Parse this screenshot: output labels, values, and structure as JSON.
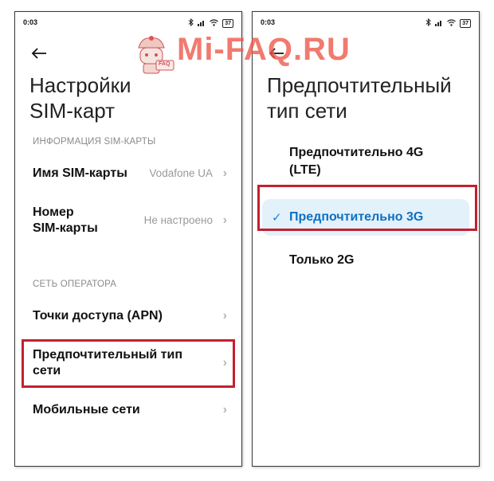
{
  "watermark": {
    "text": "Mi-FAQ.RU",
    "badge": "FAQ"
  },
  "left": {
    "status": {
      "time": "0:03",
      "battery": "37"
    },
    "title_line1": "Настройки",
    "title_line2": "SIM-карт",
    "section1": "ИНФОРМАЦИЯ SIM-КАРТЫ",
    "sim_name_label": "Имя SIM-карты",
    "sim_name_value": "Vodafone UA",
    "sim_number_label1": "Номер",
    "sim_number_label2": "SIM-карты",
    "sim_number_value": "Не настроено",
    "section2": "СЕТЬ ОПЕРАТОРА",
    "apn_label": "Точки доступа (APN)",
    "pref_label1": "Предпочтительный тип",
    "pref_label2": "сети",
    "mobile_label": "Мобильные сети"
  },
  "right": {
    "status": {
      "time": "0:03",
      "battery": "37"
    },
    "title_line1": "Предпочтительный",
    "title_line2": "тип сети",
    "opt1_line1": "Предпочтительно 4G",
    "opt1_line2": "(LTE)",
    "opt2": "Предпочтительно 3G",
    "opt3": "Только 2G"
  },
  "colors": {
    "highlight": "#c3202f",
    "selected_bg": "#e3f1fb",
    "check": "#1583d8",
    "watermark": "#ee5a4c"
  }
}
